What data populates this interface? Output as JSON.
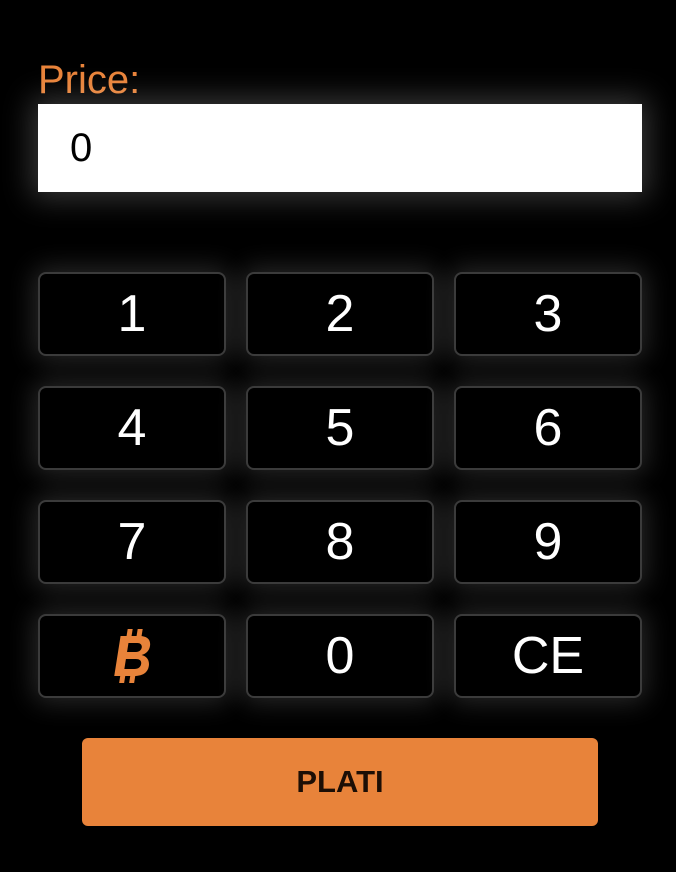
{
  "colors": {
    "accent": "#e8833a",
    "background": "#000000",
    "key_border": "#3b3b3b",
    "key_text": "#ffffff"
  },
  "price": {
    "label": "Price:",
    "value": "0"
  },
  "keypad": {
    "keys": [
      "1",
      "2",
      "3",
      "4",
      "5",
      "6",
      "7",
      "8",
      "9",
      "",
      "0",
      "CE"
    ],
    "bitcoin_key_icon": "bitcoin-icon"
  },
  "pay_button": {
    "label": "PLATI"
  }
}
